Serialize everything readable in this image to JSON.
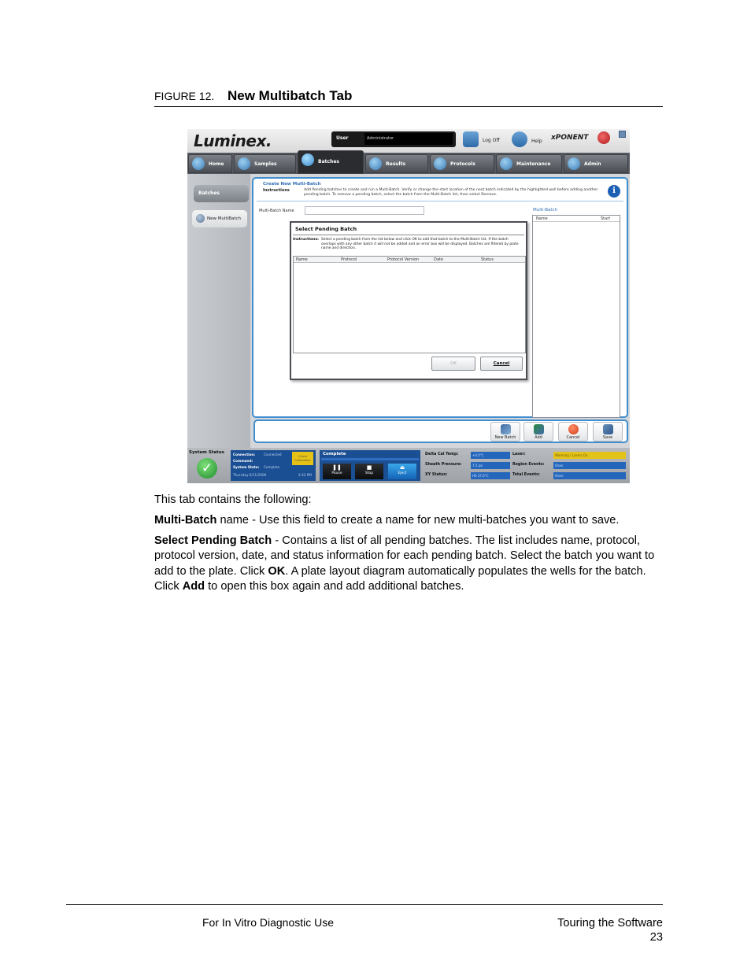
{
  "figure": {
    "label": "FIGURE 12.",
    "title": "New Multibatch Tab"
  },
  "app": {
    "logo": "Luminex.",
    "user_label": "User",
    "user_value": "Administrator",
    "logoff_label": "Log Off",
    "help_label": "Help",
    "brand": "xPONENT",
    "tabs": [
      {
        "label": "Home"
      },
      {
        "label": "Samples"
      },
      {
        "label": "Batches"
      },
      {
        "label": "Results"
      },
      {
        "label": "Protocols"
      },
      {
        "label": "Maintenance"
      },
      {
        "label": "Admin"
      }
    ],
    "sidebar": {
      "batches": "Batches",
      "new_multibatch": "New MultiBatch"
    },
    "main": {
      "title": "Create New Multi-Batch",
      "instructions_label": "Instructions",
      "instructions_text": "Add Pending batches to create and run a Multi-Batch. Verify or change the start location of the next batch indicated by the highlighted well before adding another pending batch. To remove a pending batch, select the batch from the Multi-Batch list, then select Remove.",
      "mb_name_label": "Multi-Batch Name",
      "mb_list_label": "Multi-Batch",
      "mb_columns": [
        "Name",
        "Start"
      ]
    },
    "dialog": {
      "title": "Select Pending Batch",
      "instructions_label": "Instructions:",
      "instructions_text": "Select a pending batch from the list below and click OK to add that batch to the Multi-Batch list. If the batch overlaps with any other batch it will not be added and an error box will be displayed. Batches are filtered by plate name and direction.",
      "columns": [
        "Name",
        "Protocol",
        "Protocol Version",
        "Date",
        "Status"
      ],
      "ok_label": "OK",
      "cancel_label": "Cancel"
    },
    "actions": [
      {
        "label": "New Batch"
      },
      {
        "label": "Add"
      },
      {
        "label": "Cancel"
      },
      {
        "label": "Save"
      }
    ],
    "status": {
      "system_status_label": "System Status",
      "connection_label": "Connection:",
      "connection_value": "Connected",
      "command_label": "Command:",
      "system_state_label": "System State:",
      "system_state_value": "Complete",
      "datetime": "Thursday 6/11/2009",
      "time": "2:43 PM",
      "warning": "Check Calibration",
      "run_status": "Complete",
      "pause_label": "Pause",
      "stop_label": "Stop",
      "eject_label": "Eject",
      "delta_cal_label": "Delta Cal Temp:",
      "delta_cal_value": "+0.0°C",
      "sheath_label": "Sheath Pressure:",
      "sheath_value": "7.5 psi",
      "xy_label": "XY Status:",
      "xy_value": "HS 37.0°C",
      "laser_label": "Laser:",
      "laser_value": "Warming / Lasers On",
      "region_label": "Region Events:",
      "region_value": "0/sec",
      "total_label": "Total Events:",
      "total_value": "0/sec"
    }
  },
  "body": {
    "intro": "This tab contains the following:",
    "p1_bold": "Multi-Batch",
    "p1_rest": " name - Use this field to create a name for new multi-batches you want to save.",
    "p2_bold": "Select Pending Batch",
    "p2_a": " - Contains a list of all pending batches. The list includes name, protocol, protocol version, date, and status information for each pending batch. Select the batch you want to add to the plate. Click ",
    "p2_ok": "OK",
    "p2_b": ". A plate layout diagram automatically populates the wells for the batch. Click ",
    "p2_add": "Add",
    "p2_c": " to open this box again and add additional batches."
  },
  "footer": {
    "left": "For In Vitro Diagnostic Use",
    "right_title": "Touring the Software",
    "page_number": "23"
  }
}
